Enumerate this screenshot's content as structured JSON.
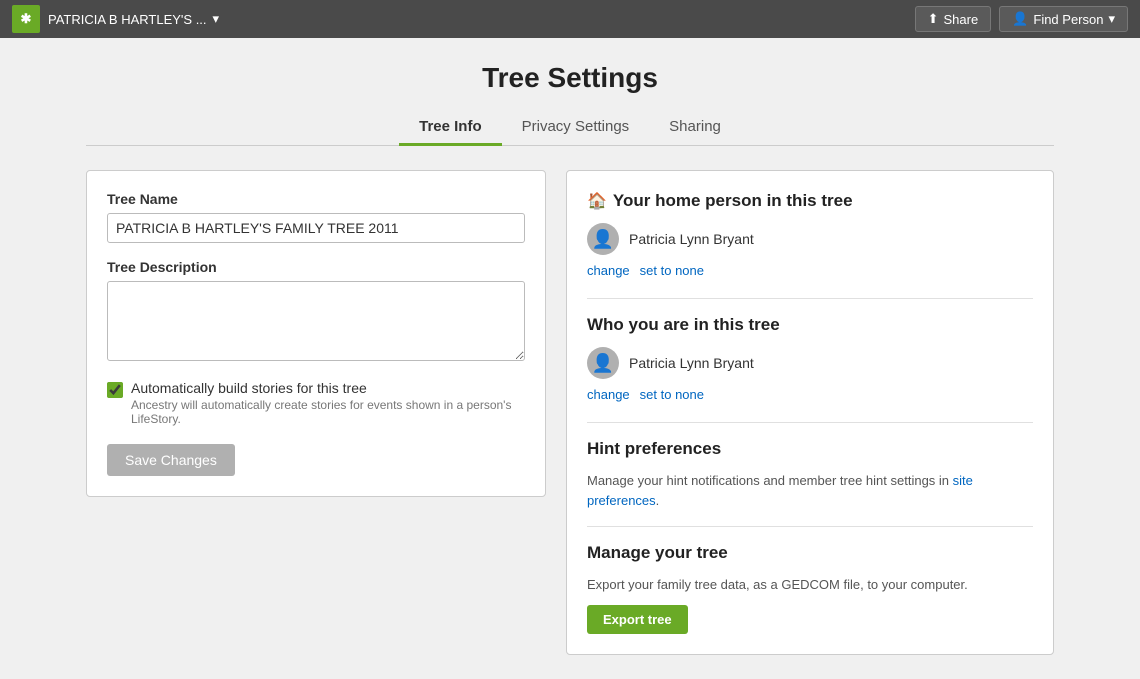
{
  "topNav": {
    "logo": "✱",
    "treeName": "PATRICIA B HARTLEY'S ...",
    "treeDropdownIcon": "▾",
    "shareLabel": "Share",
    "shareIcon": "⬆",
    "findPersonLabel": "Find Person",
    "findPersonIcon": "👤",
    "findPersonDropdownIcon": "▾"
  },
  "page": {
    "title": "Tree Settings"
  },
  "tabs": [
    {
      "id": "tree-info",
      "label": "Tree Info",
      "active": true
    },
    {
      "id": "privacy-settings",
      "label": "Privacy Settings",
      "active": false
    },
    {
      "id": "sharing",
      "label": "Sharing",
      "active": false
    }
  ],
  "leftPanel": {
    "treeNameLabel": "Tree Name",
    "treeNameValue": "PATRICIA B HARTLEY'S FAMILY TREE 2011",
    "treeNamePlaceholder": "Tree Name",
    "treeDescriptionLabel": "Tree Description",
    "treeDescriptionValue": "",
    "treeDescriptionPlaceholder": "",
    "checkboxLabel": "Automatically build stories for this tree",
    "checkboxSubLabel": "Ancestry will automatically create stories for events shown in a person's LifeStory.",
    "checkboxChecked": true,
    "saveButtonLabel": "Save Changes"
  },
  "rightPanel": {
    "homePerson": {
      "sectionTitle": "Your home person in this tree",
      "personName": "Patricia Lynn Bryant",
      "changeLabel": "change",
      "setToNoneLabel": "set to none"
    },
    "whoYouAre": {
      "sectionTitle": "Who you are in this tree",
      "personName": "Patricia Lynn Bryant",
      "changeLabel": "change",
      "setToNoneLabel": "set to none"
    },
    "hintPreferences": {
      "sectionTitle": "Hint preferences",
      "bodyText": "Manage your hint notifications and member tree hint settings in ",
      "linkText": "site preferences",
      "bodyTextEnd": "."
    },
    "manageTree": {
      "sectionTitle": "Manage your tree",
      "bodyText": "Export your family tree data, as a GEDCOM file, to your computer.",
      "exportButtonLabel": "Export tree"
    }
  }
}
